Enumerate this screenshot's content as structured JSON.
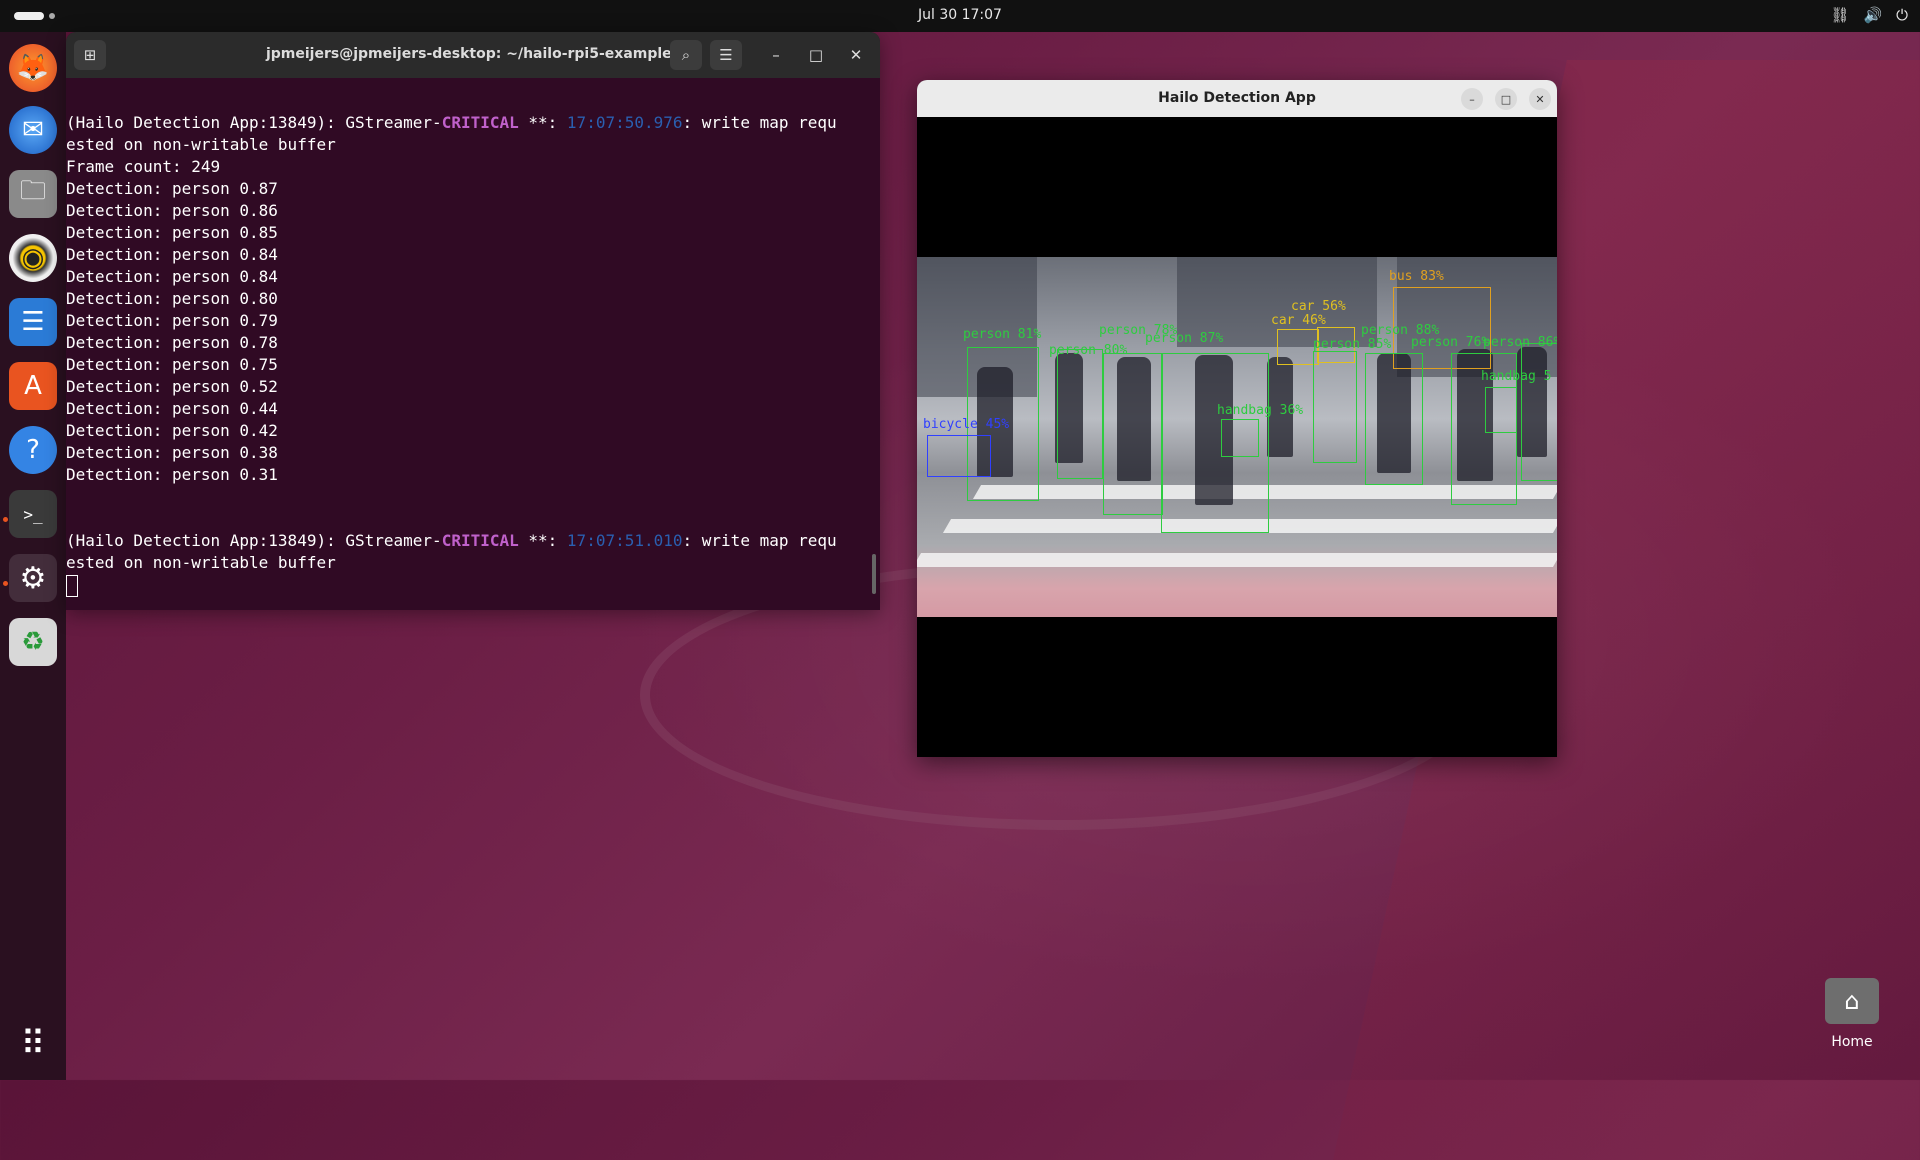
{
  "topbar": {
    "clock": "Jul 30  17:07",
    "tray_icons": [
      "network-icon",
      "volume-icon",
      "power-icon"
    ]
  },
  "dock": {
    "items": [
      {
        "name": "firefox",
        "icon": "🦊"
      },
      {
        "name": "thunderbird",
        "icon": "✉"
      },
      {
        "name": "files",
        "icon": "🗀"
      },
      {
        "name": "rhythmbox",
        "icon": "◉"
      },
      {
        "name": "libreoffice-writer",
        "icon": "☰"
      },
      {
        "name": "app-center",
        "icon": "A"
      },
      {
        "name": "help",
        "icon": "?"
      },
      {
        "name": "terminal",
        "icon": ">_"
      },
      {
        "name": "settings",
        "icon": "⚙"
      },
      {
        "name": "trash",
        "icon": "♻"
      }
    ],
    "show_apps_icon": "⠿"
  },
  "terminal": {
    "title": "jpmeijers@jpmeijers-desktop: ~/hailo-rpi5-examples",
    "lines_block1": [
      "Frame count: 249",
      "Detection: person 0.87",
      "Detection: person 0.86",
      "Detection: person 0.85",
      "Detection: person 0.84",
      "Detection: person 0.84",
      "Detection: person 0.80",
      "Detection: person 0.79",
      "Detection: person 0.78",
      "Detection: person 0.75",
      "Detection: person 0.52",
      "Detection: person 0.44",
      "Detection: person 0.42",
      "Detection: person 0.38",
      "Detection: person 0.31"
    ],
    "crit1": {
      "prefix": "(Hailo Detection App:13849): GStreamer-",
      "level": "CRITICAL",
      "mid": " **: ",
      "time": "17:07:50.976",
      "suffix": ": write map requ",
      "cont": "ested on non-writable buffer"
    },
    "crit2": {
      "prefix": "(Hailo Detection App:13849): GStreamer-",
      "level": "CRITICAL",
      "mid": " **: ",
      "time": "17:07:51.010",
      "suffix": ": write map requ",
      "cont": "ested on non-writable buffer"
    }
  },
  "detection_window": {
    "title": "Hailo Detection App",
    "labels": [
      {
        "text": "person 81%",
        "color": "#2ecc40"
      },
      {
        "text": "person 78%",
        "color": "#2ecc40"
      },
      {
        "text": "person 87%",
        "color": "#2ecc40"
      },
      {
        "text": "person 80%",
        "color": "#2ecc40"
      },
      {
        "text": "car 56%",
        "color": "#e0c020"
      },
      {
        "text": "car 46%",
        "color": "#e0c020"
      },
      {
        "text": "bus 83%",
        "color": "#e0a020"
      },
      {
        "text": "person 88%",
        "color": "#2ecc40"
      },
      {
        "text": "person 85%",
        "color": "#2ecc40"
      },
      {
        "text": "person 76%",
        "color": "#2ecc40"
      },
      {
        "text": "person 86%",
        "color": "#2ecc40"
      },
      {
        "text": "handbag 36%",
        "color": "#2ecc40"
      },
      {
        "text": "handbag 5",
        "color": "#2ecc40"
      },
      {
        "text": "bicycle 45%",
        "color": "#3040ff"
      }
    ]
  },
  "desktop": {
    "home_label": "Home"
  }
}
